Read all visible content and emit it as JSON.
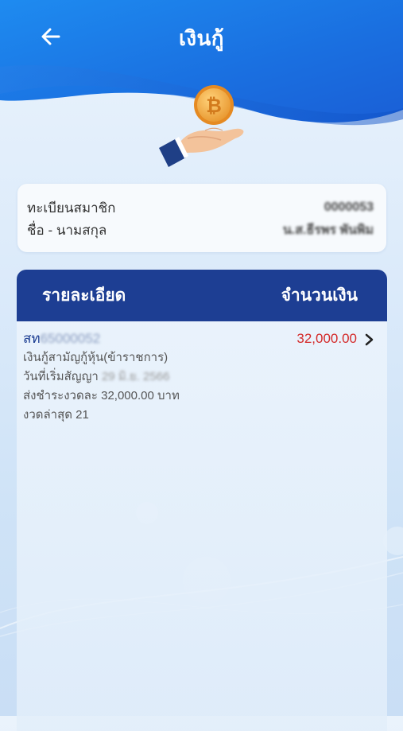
{
  "header": {
    "title": "เงินกู้",
    "back_icon": "arrow-left-icon"
  },
  "member": {
    "reg_label": "ทะเบียนสมาชิก",
    "reg_value": "0000053",
    "name_label": "ชื่อ - นามสกุล",
    "name_value": "น.ส.ธีรพร พันพิม"
  },
  "loan_table": {
    "col_detail": "รายละเอียด",
    "col_amount": "จำนวนเงิน",
    "items": [
      {
        "id_prefix": "สท",
        "id_number": "65000052",
        "amount": "32,000.00",
        "type": "เงินกู้สามัญกู้หุ้น(ข้าราชการ)",
        "start_label": "วันที่เริ่มสัญญา",
        "start_date": "29 มิ.ย. 2566",
        "installment": "ส่งชำระงวดละ 32,000.00 บาท",
        "last_period": "งวดล่าสุด 21"
      }
    ]
  },
  "colors": {
    "header_blue": "#1d6fe0",
    "panel_header": "#1d3e93",
    "amount_red": "#d42a2a"
  }
}
